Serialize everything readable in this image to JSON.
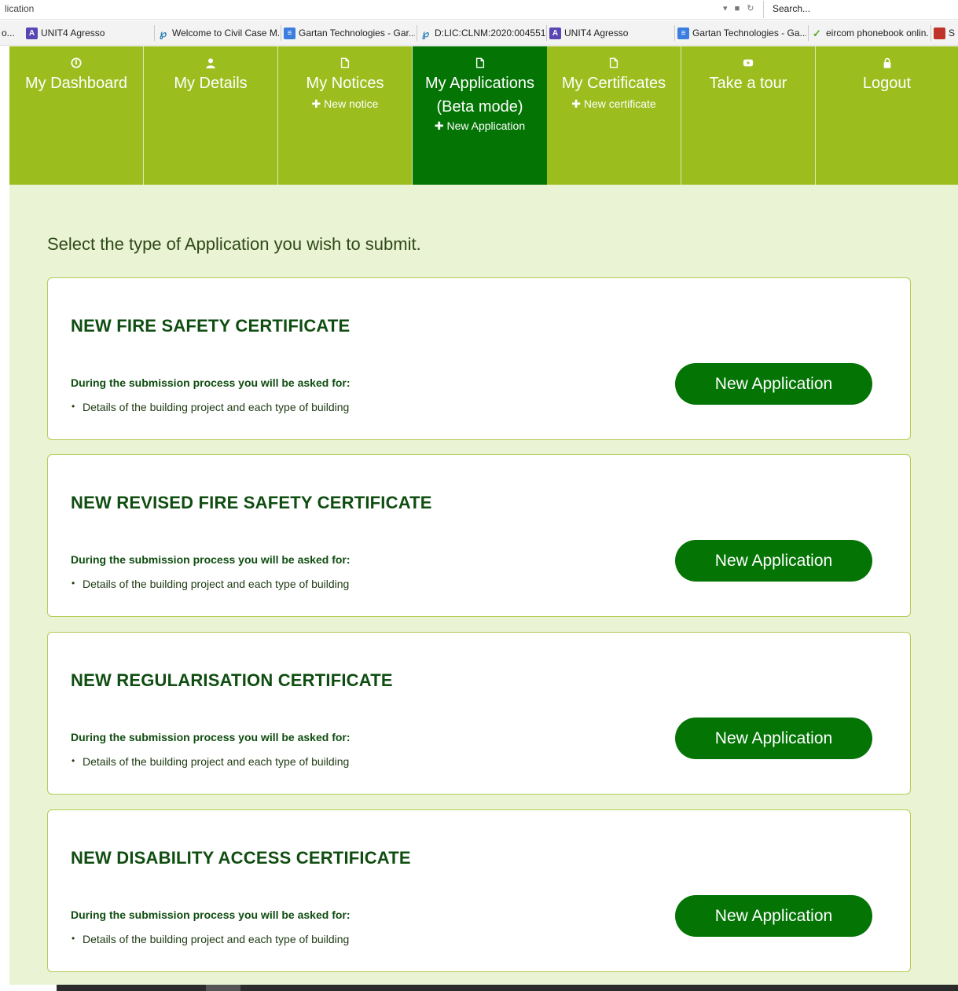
{
  "browser": {
    "address_fragment": "lication",
    "search_placeholder": "Search...",
    "bookmarks": [
      {
        "label": "o...",
        "icon": "none"
      },
      {
        "label": "UNIT4 Agresso",
        "icon": "agresso-icon"
      },
      {
        "label": "Welcome to Civil Case M...",
        "icon": "civil-case-icon"
      },
      {
        "label": "Gartan Technologies - Gar...",
        "icon": "gartan-icon"
      },
      {
        "label": "D:LIC:CLNM:2020:004551 ...",
        "icon": "civil-case-icon"
      },
      {
        "label": "UNIT4 Agresso",
        "icon": "agresso-icon"
      },
      {
        "label": "Gartan Technologies - Ga...",
        "icon": "gartan-icon"
      },
      {
        "label": "eircom phonebook onlin...",
        "icon": "eircom-icon"
      },
      {
        "label": "S",
        "icon": "s-site-icon"
      }
    ]
  },
  "nav": {
    "items": [
      {
        "label": "My Dashboard",
        "sub": "",
        "icon": "dashboard-icon",
        "active": false
      },
      {
        "label": "My Details",
        "sub": "",
        "icon": "user-icon",
        "active": false
      },
      {
        "label": "My Notices",
        "sub": "New notice",
        "icon": "document-icon",
        "active": false
      },
      {
        "label": "My Applications",
        "label2": "(Beta mode)",
        "sub": "New Application",
        "icon": "document-icon",
        "active": true
      },
      {
        "label": "My Certificates",
        "sub": "New certificate",
        "icon": "document-icon",
        "active": false
      },
      {
        "label": "Take a tour",
        "sub": "",
        "icon": "video-play-icon",
        "active": false
      },
      {
        "label": "Logout",
        "sub": "",
        "icon": "lock-icon",
        "active": false
      }
    ]
  },
  "main": {
    "prompt": "Select the type of Application you wish to submit.",
    "cards": [
      {
        "title": "NEW FIRE SAFETY CERTIFICATE",
        "subtitle": "During the submission process you will be asked for:",
        "bullet": "Details of the building project and each type of building",
        "button": "New Application"
      },
      {
        "title": "NEW REVISED FIRE SAFETY CERTIFICATE",
        "subtitle": "During the submission process you will be asked for:",
        "bullet": "Details of the building project and each type of building",
        "button": "New Application"
      },
      {
        "title": "NEW REGULARISATION CERTIFICATE",
        "subtitle": "During the submission process you will be asked for:",
        "bullet": "Details of the building project and each type of building",
        "button": "New Application"
      },
      {
        "title": "NEW DISABILITY ACCESS CERTIFICATE",
        "subtitle": "During the submission process you will be asked for:",
        "bullet": "Details of the building project and each type of building",
        "button": "New Application"
      }
    ]
  },
  "colors": {
    "nav_green": "#9bbe1e",
    "active_green": "#047505",
    "page_bg": "#eaf3d4",
    "title_green": "#0f4d10"
  }
}
